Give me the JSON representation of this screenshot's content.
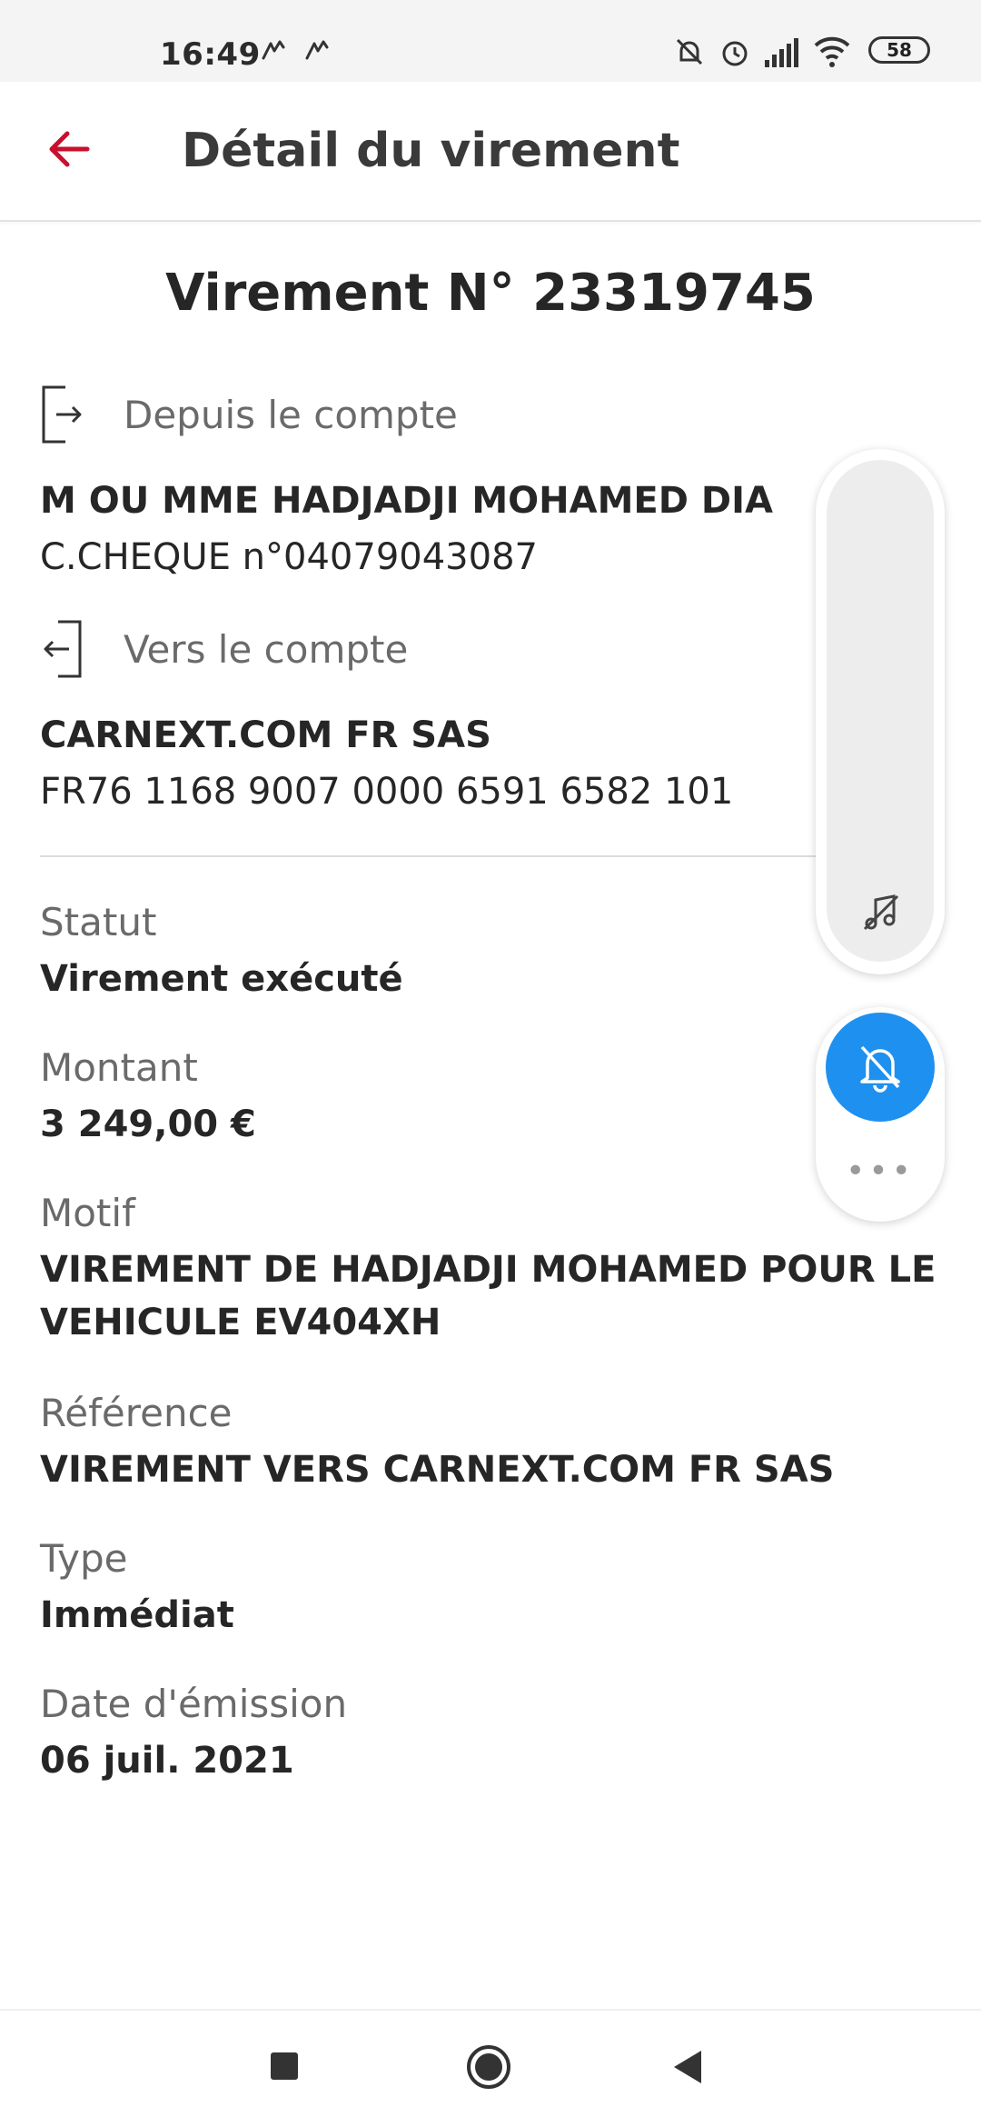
{
  "status_bar": {
    "time": "16:49",
    "battery": "58"
  },
  "header": {
    "title": "Détail du virement"
  },
  "transfer": {
    "title": "Virement N° 23319745",
    "from": {
      "label": "Depuis le compte",
      "name": "M OU MME HADJADJI MOHAMED DIA",
      "number": "C.CHEQUE n°04079043087"
    },
    "to": {
      "label": "Vers le compte",
      "name": "CARNEXT.COM FR SAS",
      "number": "FR76 1168 9007 0000 6591 6582 101"
    }
  },
  "details": [
    {
      "label": "Statut",
      "value": "Virement exécuté"
    },
    {
      "label": "Montant",
      "value": "3 249,00 €"
    },
    {
      "label": "Motif",
      "value": "VIREMENT DE HADJADJI MOHAMED POUR LE VEHICULE EV404XH"
    },
    {
      "label": "Référence",
      "value": "VIREMENT VERS CARNEXT.COM FR SAS"
    },
    {
      "label": "Type",
      "value": "Immédiat"
    },
    {
      "label": "Date d'émission",
      "value": "06 juil. 2021"
    }
  ],
  "floating": {
    "more_label": "•••"
  },
  "colors": {
    "accent": "#c8102e",
    "bell_button": "#1e90f0"
  },
  "icons": {
    "back": "arrow-left-icon",
    "from_account": "login-arrow-icon",
    "to_account": "logout-arrow-icon",
    "music_off": "music-off-icon",
    "bell_off": "bell-off-icon"
  }
}
